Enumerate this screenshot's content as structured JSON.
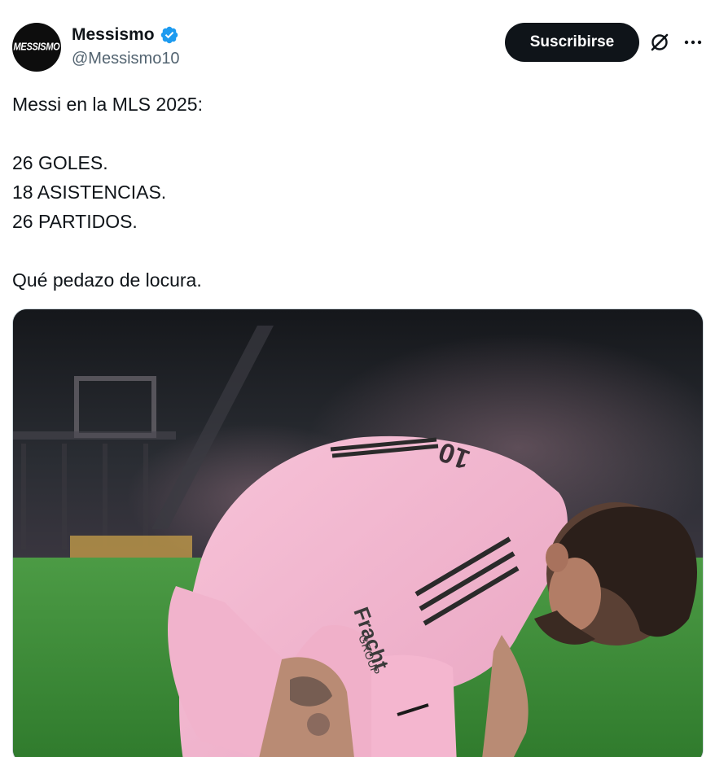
{
  "author": {
    "display_name": "Messismo",
    "handle": "@Messismo10",
    "avatar_text": "MESSISMO",
    "verified": true,
    "verified_color": "#1d9bf0"
  },
  "actions": {
    "subscribe_label": "Suscribirse",
    "grok_icon": "grok-icon",
    "more_icon": "more-horizontal-icon"
  },
  "tweet": {
    "lines": [
      "Messi en la MLS 2025:",
      "",
      "26 GOLES.",
      "18 ASISTENCIAS.",
      "26 PARTIDOS.",
      "",
      "Qué pedazo de locura."
    ]
  },
  "media": {
    "shirt_number": "10",
    "sponsor_text": "Fracht",
    "sponsor_sub": "GROUP"
  },
  "colors": {
    "text": "#0f1419",
    "secondary": "#536471",
    "button_bg": "#0f1419",
    "jersey_pink": "#f4b6cf",
    "pitch_green": "#3f8a3a"
  }
}
